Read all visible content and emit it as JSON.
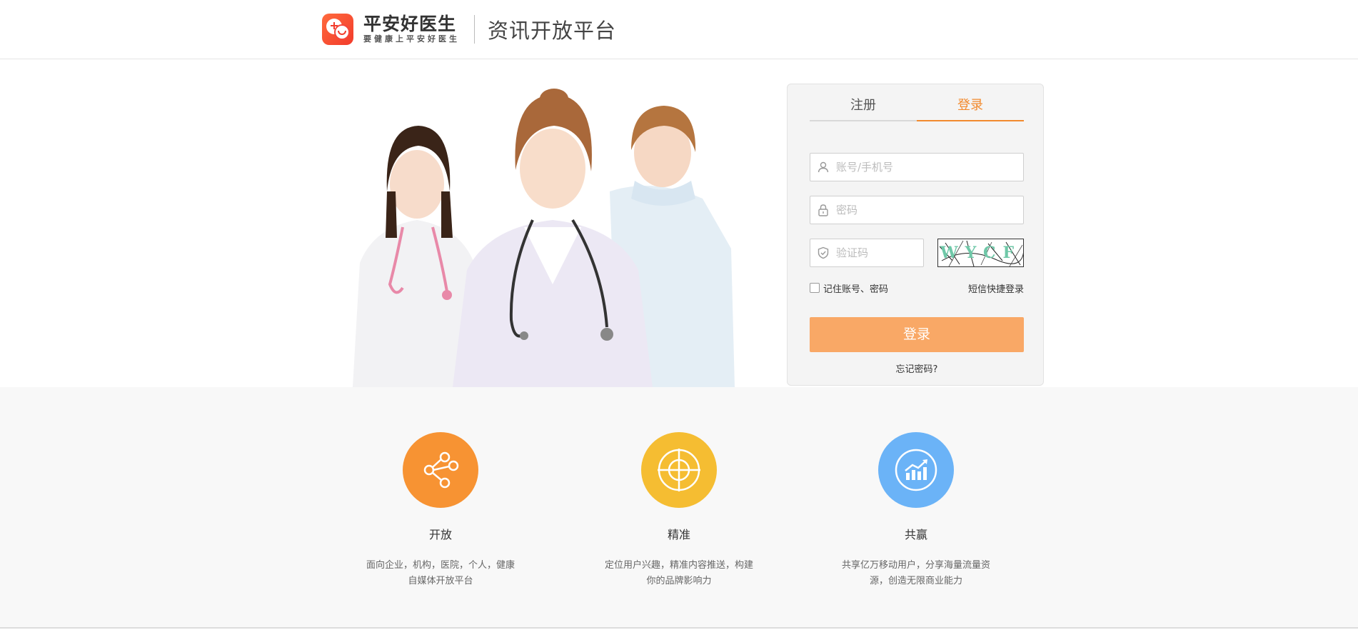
{
  "header": {
    "brand_name": "平安好医生",
    "brand_slogan": "要健康上平安好医生",
    "platform_title": "资讯开放平台"
  },
  "login": {
    "tabs": [
      {
        "label": "注册",
        "active": false
      },
      {
        "label": "登录",
        "active": true
      }
    ],
    "account_placeholder": "账号/手机号",
    "password_placeholder": "密码",
    "captcha_placeholder": "验证码",
    "captcha_text": "WYCF",
    "remember_label": "记住账号、密码",
    "sms_login_label": "短信快捷登录",
    "submit_label": "登录",
    "forgot_label": "忘记密码?"
  },
  "features": [
    {
      "title": "开放",
      "desc": "面向企业，机构，医院，个人，健康自媒体开放平台",
      "color": "#f79333",
      "icon": "share-nodes-icon"
    },
    {
      "title": "精准",
      "desc": "定位用户兴趣，精准内容推送，构建你的品牌影响力",
      "color": "#f5bd32",
      "icon": "target-icon"
    },
    {
      "title": "共赢",
      "desc": "共享亿万移动用户，分享海量流量资源，创造无限商业能力",
      "color": "#6bb3f7",
      "icon": "growth-chart-icon"
    }
  ],
  "colors": {
    "accent": "#f28a2e",
    "button": "#f9a866"
  }
}
